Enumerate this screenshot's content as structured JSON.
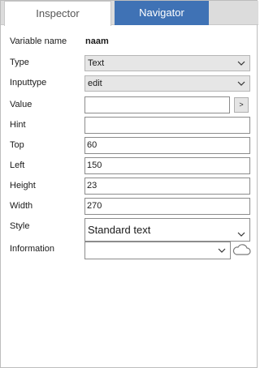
{
  "tabs": {
    "inspector": "Inspector",
    "navigator": "Navigator"
  },
  "colors": {
    "navigator_bg": "#3f72b5",
    "tabbar_bg": "#dcdcdc",
    "select_bg": "#e6e6e6"
  },
  "fields": {
    "variable_name": {
      "label": "Variable name",
      "value": "naam"
    },
    "type": {
      "label": "Type",
      "value": "Text",
      "icon": "chevron-down-icon"
    },
    "inputtype": {
      "label": "Inputtype",
      "value": "edit",
      "icon": "chevron-down-icon"
    },
    "value": {
      "label": "Value",
      "value": "",
      "button": ">"
    },
    "hint": {
      "label": "Hint",
      "value": ""
    },
    "top": {
      "label": "Top",
      "value": "60"
    },
    "left": {
      "label": "Left",
      "value": "150"
    },
    "height": {
      "label": "Height",
      "value": "23"
    },
    "width": {
      "label": "Width",
      "value": "270"
    },
    "style": {
      "label": "Style",
      "value": "Standard text",
      "icon": "chevron-down-icon"
    },
    "information": {
      "label": "Information",
      "value": "",
      "icon": "chevron-down-icon",
      "extra_icon": "cloud-icon"
    }
  }
}
